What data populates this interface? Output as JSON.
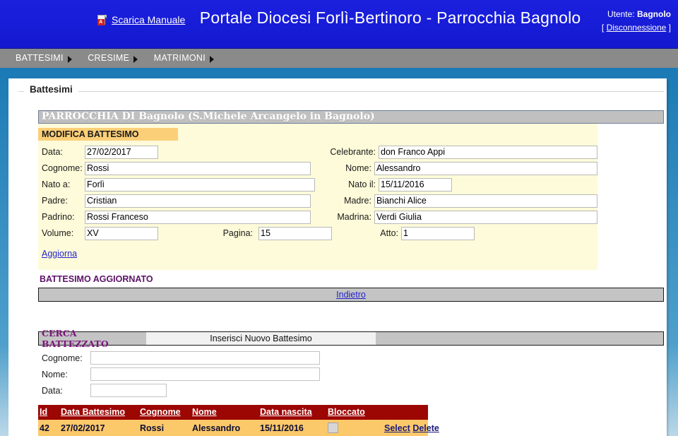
{
  "header": {
    "manual_link": "Scarica Manuale",
    "pdf_icon": "pdf-document-icon",
    "title": "Portale Diocesi Forlì-Bertinoro - Parrocchia Bagnolo",
    "user_prefix": "Utente:",
    "user_name": "Bagnolo",
    "logout_open": "[",
    "logout_label": "Disconnessione",
    "logout_close": "]"
  },
  "menu": {
    "items": [
      {
        "label": "BATTESIMI"
      },
      {
        "label": "CRESIME"
      },
      {
        "label": "MATRIMONI"
      }
    ]
  },
  "fieldset": {
    "legend": "Battesimi"
  },
  "parrocchia": {
    "title": "PARROCCHIA DI Bagnolo (S.Michele Arcangelo in Bagnolo)"
  },
  "modify_form": {
    "title": "MODIFICA BATTESIMO",
    "fields": {
      "data_label": "Data:",
      "data_value": "27/02/2017",
      "celebrante_label": "Celebrante:",
      "celebrante_value": "don Franco Appi",
      "cognome_label": "Cognome:",
      "cognome_value": "Rossi",
      "nome_label": "Nome:",
      "nome_value": "Alessandro",
      "nato_a_label": "Nato a:",
      "nato_a_value": "Forlì",
      "nato_il_label": "Nato il:",
      "nato_il_value": "15/11/2016",
      "padre_label": "Padre:",
      "padre_value": "Cristian",
      "madre_label": "Madre:",
      "madre_value": "Bianchi Alice",
      "padrino_label": "Padrino:",
      "padrino_value": "Rossi Franceso",
      "madrina_label": "Madrina:",
      "madrina_value": "Verdi Giulia",
      "volume_label": "Volume:",
      "volume_value": "XV",
      "pagina_label": "Pagina:",
      "pagina_value": "15",
      "atto_label": "Atto:",
      "atto_value": "1"
    },
    "submit_label": "Aggiorna"
  },
  "status_message": "BATTESIMO AGGIORNATO",
  "back_bar": {
    "label": "Indietro"
  },
  "search_section": {
    "title": "CERCA BATTEZZATO",
    "insert_tab_label": "Inserisci Nuovo Battesimo",
    "fields": [
      {
        "label": "Cognome:",
        "value": "",
        "placeholder": ""
      },
      {
        "label": "Nome:",
        "value": "",
        "placeholder": ""
      },
      {
        "label": "Data:",
        "value": "",
        "placeholder": ""
      }
    ]
  },
  "results_table": {
    "columns": [
      "Id",
      "Data Battesimo",
      "Cognome",
      "Nome",
      "Data nascita",
      "Bloccato",
      ""
    ],
    "rows": [
      {
        "id": "42",
        "data_battesimo": "27/02/2017",
        "cognome": "Rossi",
        "nome": "Alessandro",
        "data_nascita": "15/11/2016",
        "bloccato": false,
        "select_label": "Select",
        "delete_label": "Delete"
      }
    ]
  },
  "colors": {
    "header_blue": "#1519d6",
    "menu_gray": "#8a8a8a",
    "frame_blue": "#1b7ab5",
    "panel_yellow": "#fdfbd9",
    "title_orange": "#fbcf78",
    "table_header_red": "#9c0603",
    "table_row_amber": "#fbc96a",
    "status_purple": "#5c1268",
    "cerca_purple": "#7b177b"
  }
}
